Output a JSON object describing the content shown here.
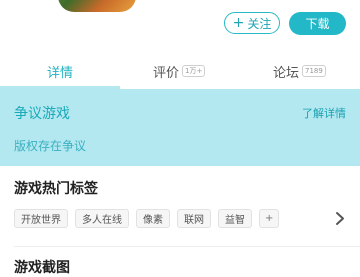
{
  "header": {
    "follow_label": "关注",
    "download_label": "下载"
  },
  "tabs": [
    {
      "label": "详情"
    },
    {
      "label": "评价",
      "count": "1万+"
    },
    {
      "label": "论坛",
      "count": "7189"
    }
  ],
  "banner": {
    "title": "争议游戏",
    "link": "了解详情",
    "subtitle": "版权存在争议"
  },
  "tags_section": {
    "title": "游戏热门标签",
    "tags": [
      "开放世界",
      "多人在线",
      "像素",
      "联网",
      "益智",
      "+"
    ]
  },
  "screenshots_section": {
    "title": "游戏截图"
  },
  "colors": {
    "accent": "#22b8c8",
    "banner_bg": "#b3e8f1"
  }
}
